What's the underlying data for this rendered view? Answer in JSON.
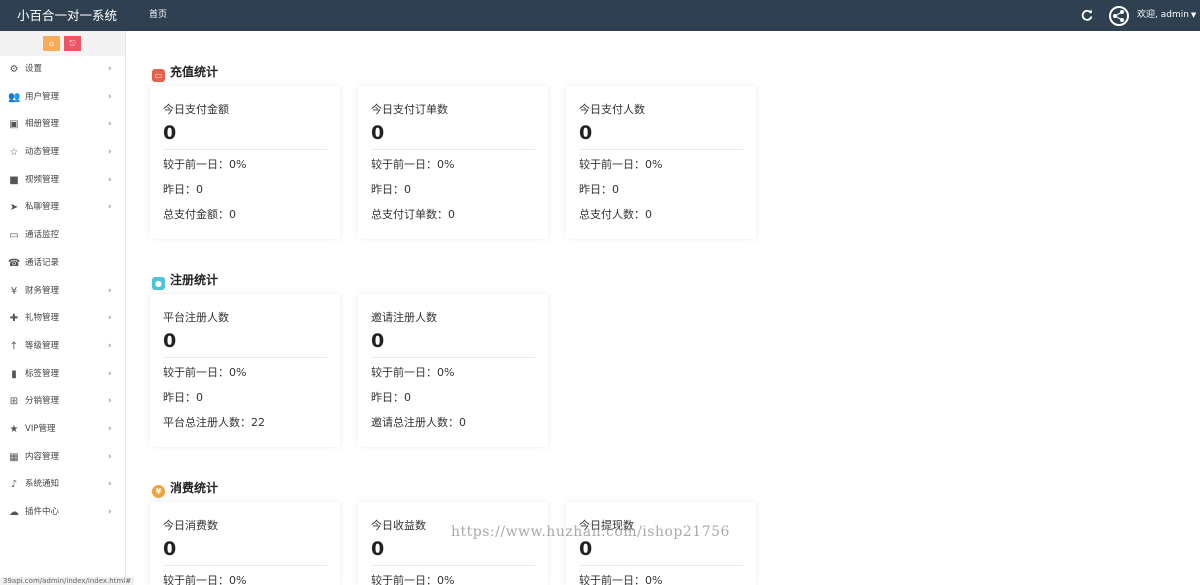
{
  "app": {
    "title": "小百合一对一系统",
    "home_tab": "首页",
    "welcome": "欢迎, admin",
    "status_url": "39api.com/admin/index/index.html#"
  },
  "watermark": "https://www.huzhan.com/ishop21756",
  "sidebar": {
    "items": [
      {
        "label": "设置",
        "icon": "gears-icon",
        "arrow": true
      },
      {
        "label": "用户管理",
        "icon": "users-icon",
        "arrow": true
      },
      {
        "label": "相册管理",
        "icon": "image-icon",
        "arrow": true
      },
      {
        "label": "动态管理",
        "icon": "star-outline-icon",
        "arrow": true
      },
      {
        "label": "视频管理",
        "icon": "video-camera-icon",
        "arrow": true
      },
      {
        "label": "私聊管理",
        "icon": "telegram-icon",
        "arrow": true
      },
      {
        "label": "通话监控",
        "icon": "monitor-icon",
        "arrow": false
      },
      {
        "label": "通话记录",
        "icon": "phone-icon",
        "arrow": false
      },
      {
        "label": "财务管理",
        "icon": "yen-icon",
        "arrow": true
      },
      {
        "label": "礼物管理",
        "icon": "gift-icon",
        "arrow": true
      },
      {
        "label": "等级管理",
        "icon": "level-up-icon",
        "arrow": true
      },
      {
        "label": "标签管理",
        "icon": "bookmark-icon",
        "arrow": true
      },
      {
        "label": "分销管理",
        "icon": "sitemap-icon",
        "arrow": true
      },
      {
        "label": "VIP管理",
        "icon": "star-icon",
        "arrow": true
      },
      {
        "label": "内容管理",
        "icon": "grid-icon",
        "arrow": true
      },
      {
        "label": "系统通知",
        "icon": "bell-icon",
        "arrow": true
      },
      {
        "label": "插件中心",
        "icon": "cloud-icon",
        "arrow": true
      }
    ]
  },
  "sections": [
    {
      "title": "充值统计",
      "icon": "wallet-icon",
      "color": "#e8604c",
      "cards": [
        {
          "title": "今日支付金额",
          "value": "0",
          "rows": [
            "较于前一日：0%",
            "昨日：0",
            "总支付金额：0"
          ]
        },
        {
          "title": "今日支付订单数",
          "value": "0",
          "rows": [
            "较于前一日：0%",
            "昨日：0",
            "总支付订单数：0"
          ]
        },
        {
          "title": "今日支付人数",
          "value": "0",
          "rows": [
            "较于前一日：0%",
            "昨日：0",
            "总支付人数：0"
          ]
        }
      ]
    },
    {
      "title": "注册统计",
      "icon": "user-icon",
      "color": "#4fc3d9",
      "cards": [
        {
          "title": "平台注册人数",
          "value": "0",
          "rows": [
            "较于前一日：0%",
            "昨日：0",
            "平台总注册人数：22"
          ]
        },
        {
          "title": "邀请注册人数",
          "value": "0",
          "rows": [
            "较于前一日：0%",
            "昨日：0",
            "邀请总注册人数：0"
          ]
        }
      ]
    },
    {
      "title": "消费统计",
      "icon": "yen-circle-icon",
      "color": "#f0a23b",
      "cards": [
        {
          "title": "今日消费数",
          "value": "0",
          "rows": [
            "较于前一日：0%"
          ]
        },
        {
          "title": "今日收益数",
          "value": "0",
          "rows": [
            "较于前一日：0%"
          ]
        },
        {
          "title": "今日提现数",
          "value": "0",
          "rows": [
            "较于前一日：0%"
          ]
        }
      ]
    }
  ]
}
